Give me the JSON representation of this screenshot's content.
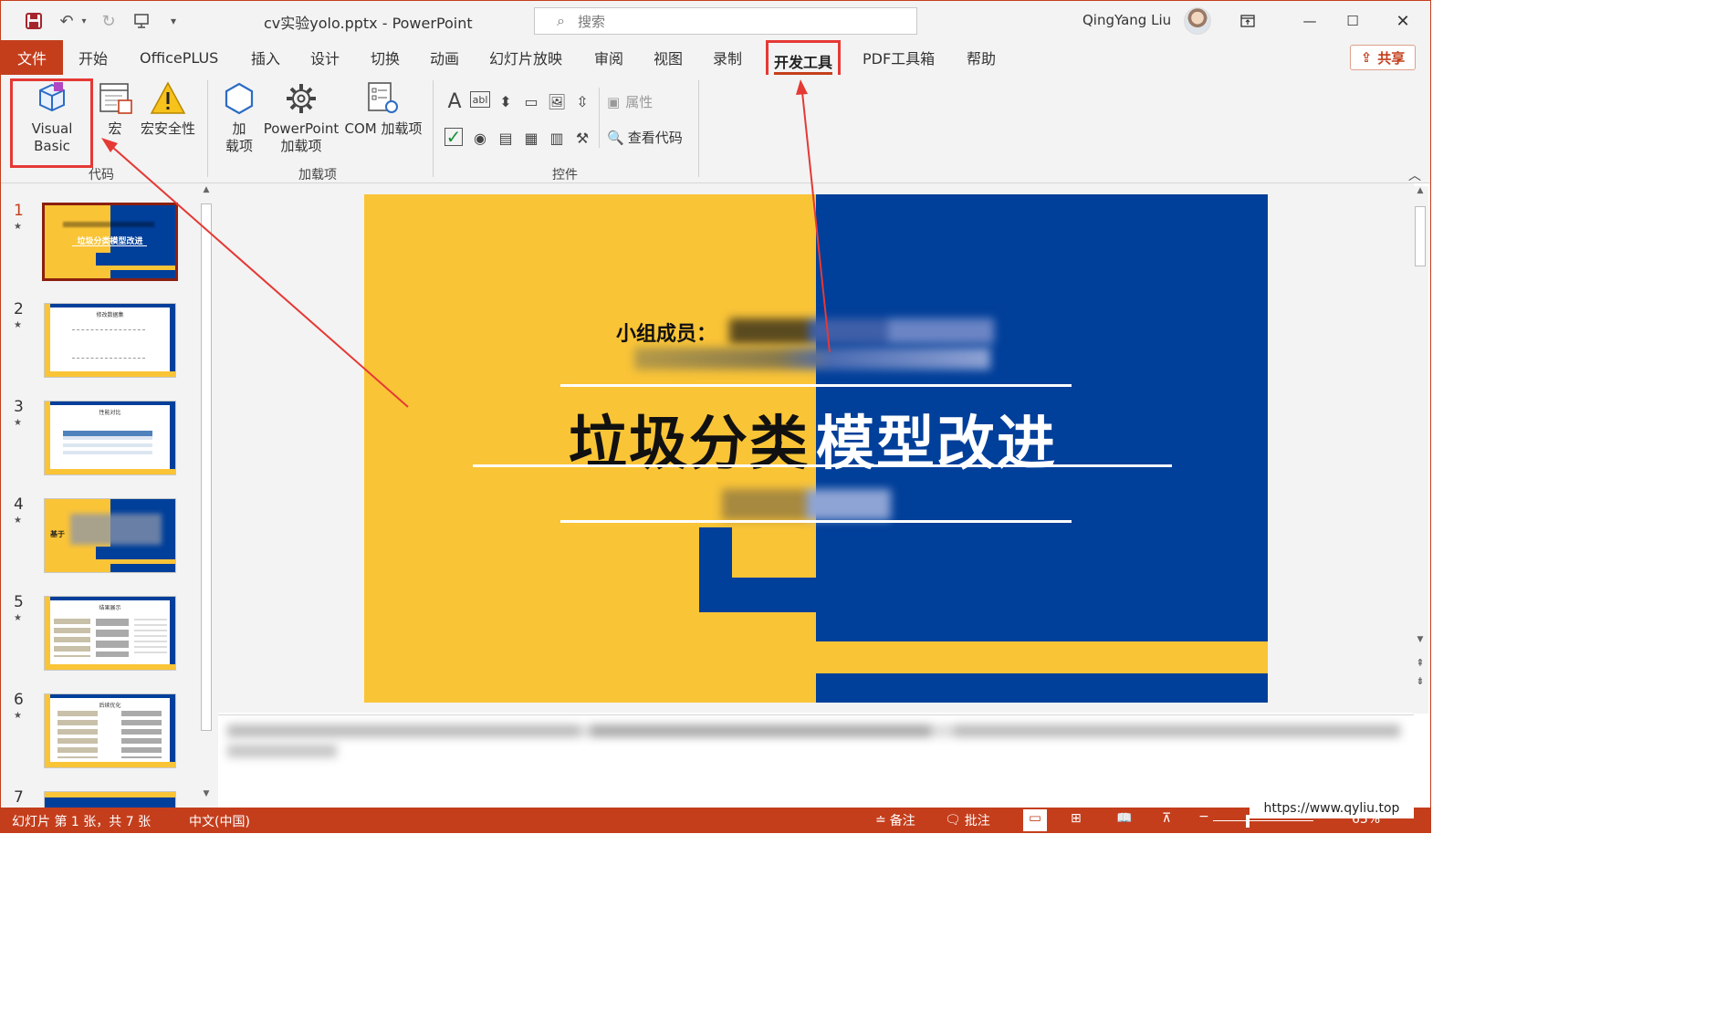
{
  "window": {
    "title": "cv实验yolo.pptx  -  PowerPoint",
    "search_placeholder": "搜索",
    "user_name": "QingYang Liu"
  },
  "quick_access": {
    "icons": [
      "save-icon",
      "undo-icon",
      "redo-icon",
      "present-from-start-icon",
      "customize-dropdown-icon"
    ]
  },
  "tabs": [
    "文件",
    "开始",
    "OfficePLUS",
    "插入",
    "设计",
    "切换",
    "动画",
    "幻灯片放映",
    "审阅",
    "视图",
    "录制",
    "开发工具",
    "PDF工具箱",
    "帮助"
  ],
  "active_tab": "开发工具",
  "share_label": "共享",
  "ribbon": {
    "code_group": {
      "label": "代码",
      "visual_basic": "Visual Basic",
      "macro": "宏",
      "macro_security": "宏安全性"
    },
    "addins_group": {
      "label": "加载项",
      "addins_line1": "加",
      "addins_line2": "载项",
      "ppt_addins_line1": "PowerPoint",
      "ppt_addins_line2": "加载项",
      "com_addins": "COM 加载项"
    },
    "controls_group": {
      "label": "控件",
      "properties": "属性",
      "view_code": "查看代码"
    }
  },
  "slides": {
    "numbers": [
      "1",
      "2",
      "3",
      "4",
      "5",
      "6",
      "7"
    ],
    "star": "★",
    "thumb_titles": [
      "垃圾分类模型改进",
      "修改数据集",
      "性能对比",
      "基于",
      "结果展示",
      "后续优化",
      ""
    ]
  },
  "slide": {
    "members_label": "小组成员：",
    "title_part1": "垃圾分类",
    "title_part2": "模型改进"
  },
  "status": {
    "slide_info": "幻灯片 第 1 张，共 7 张",
    "language": "中文(中国)",
    "notes": "备注",
    "comments": "批注",
    "zoom": "63%"
  },
  "watermark": "https://www.qyliu.top",
  "colors": {
    "accent": "#c43e1c",
    "slide_yellow": "#fac437",
    "slide_blue": "#003f9a",
    "highlight_red": "#e53935"
  }
}
